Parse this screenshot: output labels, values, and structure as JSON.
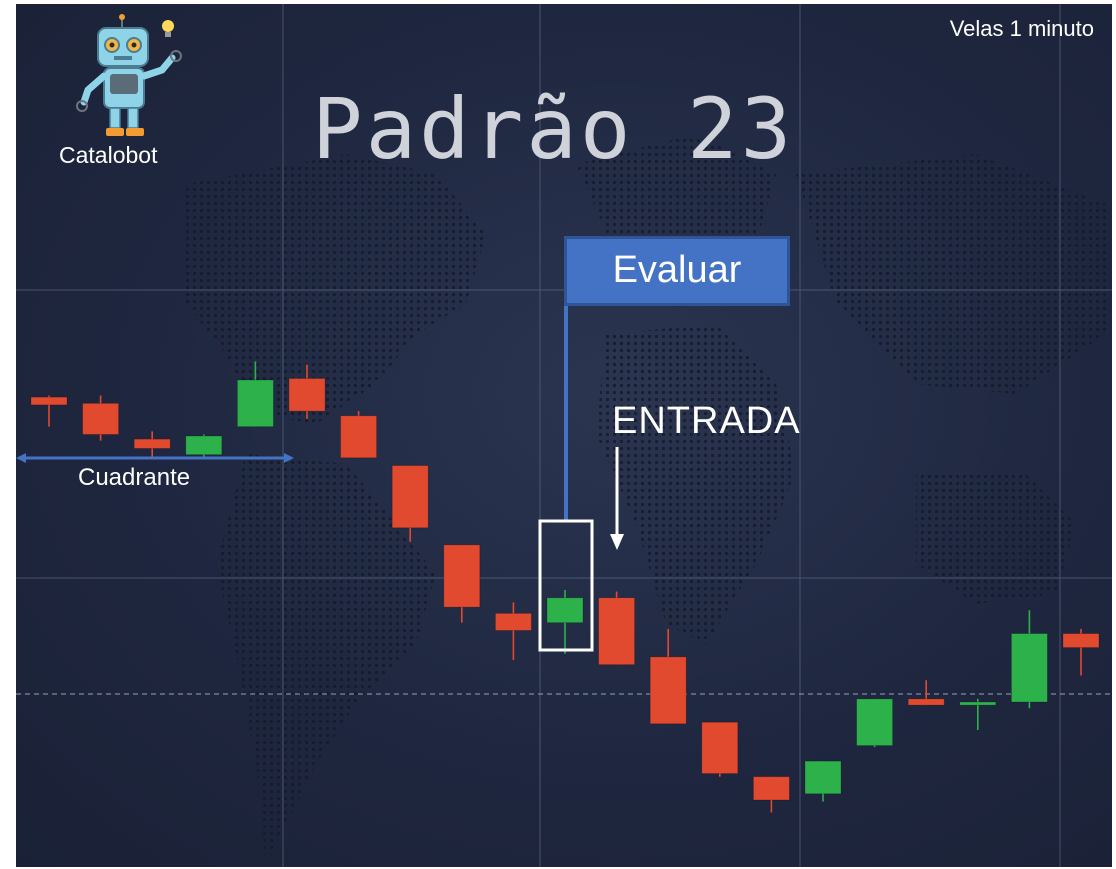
{
  "header": {
    "title": "Padrão 23",
    "timeframe": "Velas 1 minuto",
    "bot_name": "Catalobot"
  },
  "annotations": {
    "quadrant": "Cuadrante",
    "evaluate": "Evaluar",
    "entry": "ENTRADA"
  },
  "colors": {
    "background": "#1f2740",
    "bullish": "#2db14b",
    "bearish": "#e24a30",
    "annotation_blue": "#4472c4",
    "highlight_box": "#ffffff"
  },
  "chart_data": {
    "type": "candlestick",
    "title": "Padrão 23",
    "grid": true,
    "evaluated_candle_index": 10,
    "entry_candle_index": 11,
    "candles": [
      {
        "open": 96.2,
        "close": 95.7,
        "high": 96.3,
        "low": 94.3,
        "direction": "bearish"
      },
      {
        "open": 95.8,
        "close": 93.8,
        "high": 96.3,
        "low": 93.4,
        "direction": "bearish"
      },
      {
        "open": 93.5,
        "close": 92.9,
        "high": 94.0,
        "low": 92.3,
        "direction": "bearish"
      },
      {
        "open": 92.5,
        "close": 93.7,
        "high": 93.8,
        "low": 92.3,
        "direction": "bullish"
      },
      {
        "open": 94.3,
        "close": 97.3,
        "high": 98.5,
        "low": 94.3,
        "direction": "bullish"
      },
      {
        "open": 97.4,
        "close": 95.3,
        "high": 98.3,
        "low": 94.8,
        "direction": "bearish"
      },
      {
        "open": 95.0,
        "close": 92.3,
        "high": 95.3,
        "low": 92.3,
        "direction": "bearish"
      },
      {
        "open": 91.8,
        "close": 87.8,
        "high": 91.8,
        "low": 86.9,
        "direction": "bearish"
      },
      {
        "open": 86.7,
        "close": 82.7,
        "high": 86.7,
        "low": 81.7,
        "direction": "bearish"
      },
      {
        "open": 82.3,
        "close": 81.2,
        "high": 83.0,
        "low": 79.3,
        "direction": "bearish"
      },
      {
        "open": 81.7,
        "close": 83.3,
        "high": 83.8,
        "low": 79.7,
        "direction": "bullish"
      },
      {
        "open": 83.3,
        "close": 79.0,
        "high": 83.7,
        "low": 79.0,
        "direction": "bearish"
      },
      {
        "open": 79.5,
        "close": 75.2,
        "high": 81.3,
        "low": 75.2,
        "direction": "bearish"
      },
      {
        "open": 75.3,
        "close": 72.0,
        "high": 75.3,
        "low": 71.8,
        "direction": "bearish"
      },
      {
        "open": 71.8,
        "close": 70.3,
        "high": 71.8,
        "low": 69.5,
        "direction": "bearish"
      },
      {
        "open": 70.7,
        "close": 72.8,
        "high": 72.8,
        "low": 70.2,
        "direction": "bullish"
      },
      {
        "open": 73.8,
        "close": 76.8,
        "high": 76.8,
        "low": 73.7,
        "direction": "bullish"
      },
      {
        "open": 76.8,
        "close": 76.4,
        "high": 78.0,
        "low": 76.4,
        "direction": "bearish"
      },
      {
        "open": 76.4,
        "close": 76.6,
        "high": 76.8,
        "low": 74.8,
        "direction": "bullish"
      },
      {
        "open": 76.6,
        "close": 81.0,
        "high": 82.5,
        "low": 76.2,
        "direction": "bullish"
      },
      {
        "open": 81.0,
        "close": 80.1,
        "high": 81.3,
        "low": 78.3,
        "direction": "bearish"
      }
    ]
  }
}
